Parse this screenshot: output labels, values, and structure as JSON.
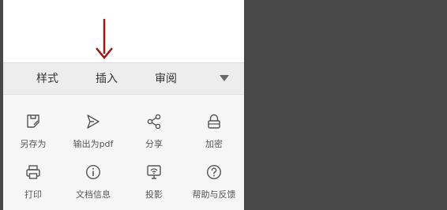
{
  "tabs": [
    "样式",
    "插入",
    "审阅"
  ],
  "tools_row1": [
    "另存为",
    "输出为pdf",
    "分享",
    "加密"
  ],
  "tools_row2": [
    "打印",
    "文档信息",
    "投影",
    "帮助与反馈"
  ],
  "icons": {
    "save_as": "save-as-icon",
    "export_pdf": "send-arrow-icon",
    "share": "share-icon",
    "encrypt": "lock-icon",
    "print": "printer-icon",
    "doc_info": "info-icon",
    "projection": "projector-icon",
    "help": "help-icon",
    "dropdown": "chevron-down-icon",
    "annotation": "down-arrow-icon"
  },
  "colors": {
    "annotation_arrow": "#a31414",
    "background": "#484848",
    "panel": "#f6f6f6",
    "tabbar": "#ededed"
  }
}
